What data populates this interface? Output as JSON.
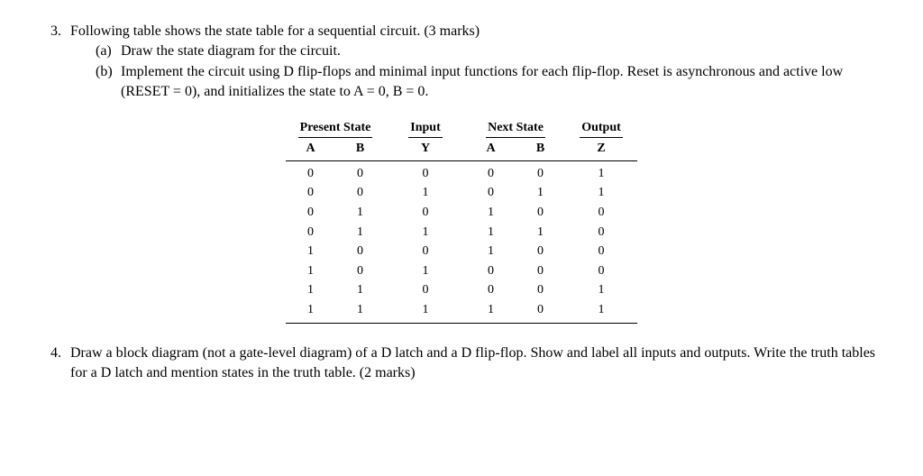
{
  "q3": {
    "number": "3.",
    "intro": "Following table shows the state table for a sequential circuit. (3 marks)",
    "a_label": "(a)",
    "a_text": "Draw the state diagram for the circuit.",
    "b_label": "(b)",
    "b_text": "Implement the circuit using D flip-flops and minimal input functions for each flip-flop. Reset is asynchronous and active low (RESET = 0), and initializes the state to A = 0, B = 0."
  },
  "table": {
    "headers": {
      "present": "Present State",
      "input": "Input",
      "next": "Next State",
      "output": "Output"
    },
    "subheaders": {
      "ps_a": "A",
      "ps_b": "B",
      "in_y": "Y",
      "ns_a": "A",
      "ns_b": "B",
      "out_z": "Z"
    },
    "rows": [
      {
        "psa": "0",
        "psb": "0",
        "y": "0",
        "nsa": "0",
        "nsb": "0",
        "z": "1"
      },
      {
        "psa": "0",
        "psb": "0",
        "y": "1",
        "nsa": "0",
        "nsb": "1",
        "z": "1"
      },
      {
        "psa": "0",
        "psb": "1",
        "y": "0",
        "nsa": "1",
        "nsb": "0",
        "z": "0"
      },
      {
        "psa": "0",
        "psb": "1",
        "y": "1",
        "nsa": "1",
        "nsb": "1",
        "z": "0"
      },
      {
        "psa": "1",
        "psb": "0",
        "y": "0",
        "nsa": "1",
        "nsb": "0",
        "z": "0"
      },
      {
        "psa": "1",
        "psb": "0",
        "y": "1",
        "nsa": "0",
        "nsb": "0",
        "z": "0"
      },
      {
        "psa": "1",
        "psb": "1",
        "y": "0",
        "nsa": "0",
        "nsb": "0",
        "z": "1"
      },
      {
        "psa": "1",
        "psb": "1",
        "y": "1",
        "nsa": "1",
        "nsb": "0",
        "z": "1"
      }
    ]
  },
  "q4": {
    "number": "4.",
    "text": "Draw a block diagram (not a gate-level diagram) of a D latch and a D flip-flop. Show and label all inputs and outputs. Write the truth tables for a D latch and mention states in the truth table. (2 marks)"
  },
  "chart_data": {
    "type": "table",
    "title": "State table for a sequential circuit",
    "columns": [
      "Present A",
      "Present B",
      "Input Y",
      "Next A",
      "Next B",
      "Output Z"
    ],
    "rows": [
      [
        0,
        0,
        0,
        0,
        0,
        1
      ],
      [
        0,
        0,
        1,
        0,
        1,
        1
      ],
      [
        0,
        1,
        0,
        1,
        0,
        0
      ],
      [
        0,
        1,
        1,
        1,
        1,
        0
      ],
      [
        1,
        0,
        0,
        1,
        0,
        0
      ],
      [
        1,
        0,
        1,
        0,
        0,
        0
      ],
      [
        1,
        1,
        0,
        0,
        0,
        1
      ],
      [
        1,
        1,
        1,
        1,
        0,
        1
      ]
    ]
  }
}
